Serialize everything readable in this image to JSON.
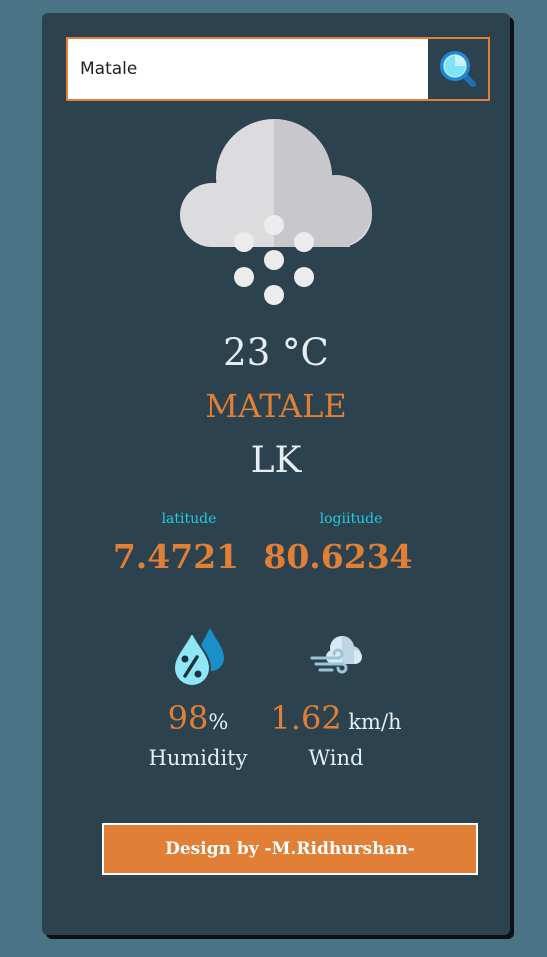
{
  "search": {
    "value": "Matale",
    "icon": "search-icon"
  },
  "weather": {
    "icon": "cloud-snow-icon",
    "temperature": "23 °C",
    "city": "MATALE",
    "country": "LK"
  },
  "coordinates": {
    "latitude_label": "latitude",
    "latitude_value": "7.4721",
    "longitude_label": "logiitude",
    "longitude_value": "80.6234"
  },
  "humidity": {
    "icon": "humidity-drops-icon",
    "value": "98",
    "unit": "%",
    "label": "Humidity"
  },
  "wind": {
    "icon": "wind-cloud-icon",
    "value": "1.62",
    "unit": " km/h",
    "label": "Wind"
  },
  "footer": {
    "credit": "Design by -M.Ridhurshan-"
  },
  "colors": {
    "page_background": "#4a7385",
    "card_background": "#2c434f",
    "accent": "#e07f35",
    "label_cyan": "#28c8e0",
    "text_light": "#e6eef2"
  }
}
